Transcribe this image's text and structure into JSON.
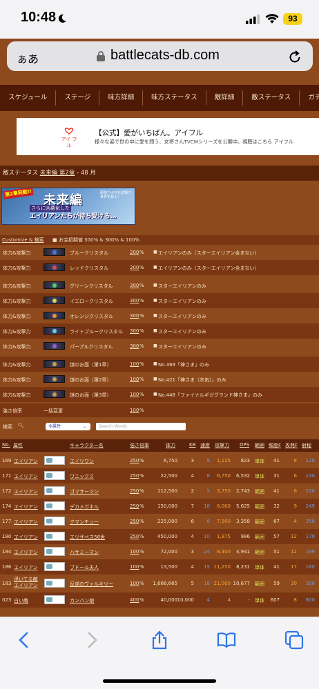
{
  "status": {
    "time": "10:48",
    "battery": "93"
  },
  "browser": {
    "aa": "ぁあ",
    "url": "battlecats-db.com"
  },
  "nav": [
    "スケジュール",
    "ステージ",
    "味方詳細",
    "味方ステータス",
    "敵詳細",
    "敵ステータス",
    "ガチャ"
  ],
  "ad": {
    "logo": "アイ フル",
    "title": "【公式】愛がいちばん。アイフル",
    "sub": "様々な姿で世の中に愛を問う、女将さんTVCMシリーズを公開中。視聴はこちら アイフル"
  },
  "crumb": {
    "prefix": "敵ステータス",
    "link": "未来編 第2章",
    "suffix": "- 48 月"
  },
  "banner": {
    "badge": "第2章発動!!",
    "title": "未来編",
    "sub": "さらに凶悪化した",
    "line": "エイリアンたちが待ち受ける…",
    "side": "超強力ボスも登場!? 世界を救え!"
  },
  "customize": {
    "link": "Customize & 検索",
    "text": "■ お宝初期値 300% & 300% & 100%"
  },
  "treasures": [
    {
      "label": "体力&攻撃力",
      "name": "ブルークリスタル",
      "pct": "200",
      "color": "#4a7ad8",
      "note": "エイリアンのみ（スターエイリアン含まない）"
    },
    {
      "label": "体力&攻撃力",
      "name": "レッドクリスタル",
      "pct": "200",
      "color": "#d84a5a",
      "note": "エイリアンのみ（スターエイリアン含まない）"
    },
    {
      "label": "体力&攻撃力",
      "name": "グリーンクリスタル",
      "pct": "300",
      "color": "#4ad85a",
      "note": "スターエイリアンのみ"
    },
    {
      "label": "体力&攻撃力",
      "name": "イエロークリスタル",
      "pct": "300",
      "color": "#d8d84a",
      "note": "スターエイリアンのみ"
    },
    {
      "label": "体力&攻撃力",
      "name": "オレンジクリスタル",
      "pct": "300",
      "color": "#e8923a",
      "note": "スターエイリアンのみ"
    },
    {
      "label": "体力&攻撃力",
      "name": "ライトブルークリスタル",
      "pct": "300",
      "color": "#6ad0f0",
      "note": "スターエイリアンのみ"
    },
    {
      "label": "体力&攻撃力",
      "name": "パープルクリスタル",
      "pct": "300",
      "color": "#a05ad8",
      "note": "スターエイリアンのみ"
    },
    {
      "label": "体力&攻撃力",
      "name": "謎のお面（第1章）",
      "pct": "100",
      "color": "#caa040",
      "note": "No.369「神さま」のみ"
    },
    {
      "label": "体力&攻撃力",
      "name": "謎のお面（第2章）",
      "pct": "100",
      "color": "#caa040",
      "note": "No.421「神さま（本気）」のみ"
    },
    {
      "label": "体力&攻撃力",
      "name": "謎のお面（第3章）",
      "pct": "100",
      "color": "#caa040",
      "note": "No.448「ファイナルギガグランド神さま」のみ"
    }
  ],
  "strength": {
    "label": "強さ倍率",
    "name": "一括変更",
    "pct": "100",
    "unit": "%"
  },
  "search": {
    "label": "検索",
    "select": "全属性",
    "placeholder": "Search Words"
  },
  "headers": {
    "no": "No.",
    "attr": "属性",
    "name": "キャラクター名",
    "mult": "強さ倍率",
    "hp": "体力",
    "kb": "KB",
    "speed": "速度",
    "atk": "攻撃力",
    "dps": "DPS",
    "range": "範囲",
    "freq": "頻度F",
    "atkf": "攻発F",
    "range2": "射程"
  },
  "rows": [
    {
      "no": "169",
      "attr": "エイリアン",
      "name": "エイリワン",
      "mult": "250",
      "hp": "6,750",
      "kb": "3",
      "sp": "8",
      "atk": "1,125",
      "dps": "823",
      "rng": "単体",
      "freq": "41",
      "af": "8",
      "r2": "120"
    },
    {
      "no": "171",
      "attr": "エイリアン",
      "name": "ワニックス",
      "mult": "250",
      "hp": "22,500",
      "kb": "4",
      "sp": "8",
      "atk": "6,750",
      "dps": "6,532",
      "rng": "単体",
      "freq": "31",
      "af": "6",
      "r2": "130"
    },
    {
      "no": "172",
      "attr": "エイリアン",
      "name": "ゴマサーマン",
      "mult": "250",
      "hp": "112,500",
      "kb": "2",
      "sp": "5",
      "atk": "3,750",
      "dps": "2,743",
      "rng": "範囲",
      "freq": "41",
      "af": "6",
      "r2": "220"
    },
    {
      "no": "174",
      "attr": "エイリアン",
      "name": "デカメガネル",
      "mult": "250",
      "hp": "150,000",
      "kb": "7",
      "sp": "18",
      "atk": "6,000",
      "dps": "5,625",
      "rng": "範囲",
      "freq": "32",
      "af": "9",
      "r2": "249"
    },
    {
      "no": "177",
      "attr": "エイリアン",
      "name": "クマンチュー",
      "mult": "250",
      "hp": "225,000",
      "kb": "6",
      "sp": "8",
      "atk": "7,500",
      "dps": "3,358",
      "rng": "範囲",
      "freq": "67",
      "af": "4",
      "r2": "350"
    },
    {
      "no": "180",
      "attr": "エイリアン",
      "name": "エリザベス56世",
      "mult": "250",
      "hp": "450,000",
      "kb": "4",
      "sp": "10",
      "atk": "1,875",
      "dps": "986",
      "rng": "範囲",
      "freq": "57",
      "af": "12",
      "r2": "170"
    },
    {
      "no": "184",
      "attr": "エイリアン",
      "name": "ハサミーマン",
      "mult": "100",
      "hp": "72,000",
      "kb": "3",
      "sp": "24",
      "atk": "8,400",
      "dps": "4,941",
      "rng": "範囲",
      "freq": "51",
      "af": "12",
      "r2": "199"
    },
    {
      "no": "186",
      "attr": "エイリアン",
      "name": "ブドール夫人",
      "mult": "100",
      "hp": "13,500",
      "kb": "4",
      "sp": "15",
      "atk": "11,250",
      "dps": "8,231",
      "rng": "単体",
      "freq": "41",
      "af": "17",
      "r2": "160"
    },
    {
      "no": "183",
      "attr": "浮いてる敵 エイリアン",
      "name": "反逆のヴァルキリー",
      "mult": "100",
      "hp": "1,666,665",
      "kb": "5",
      "sp": "18",
      "atk": "21,000",
      "dps": "10,677",
      "rng": "範囲",
      "freq": "59",
      "af": "20",
      "r2": "350"
    },
    {
      "no": "023",
      "attr": "白い敵",
      "name": "カンバン娘",
      "mult": "400",
      "hp": "40,000",
      "kb": "10,000",
      "sp": "4",
      "atk": "4",
      "dps": "-",
      "rng": "単体",
      "freq": "607",
      "af": "8",
      "r2": "800"
    }
  ],
  "pct": "%"
}
